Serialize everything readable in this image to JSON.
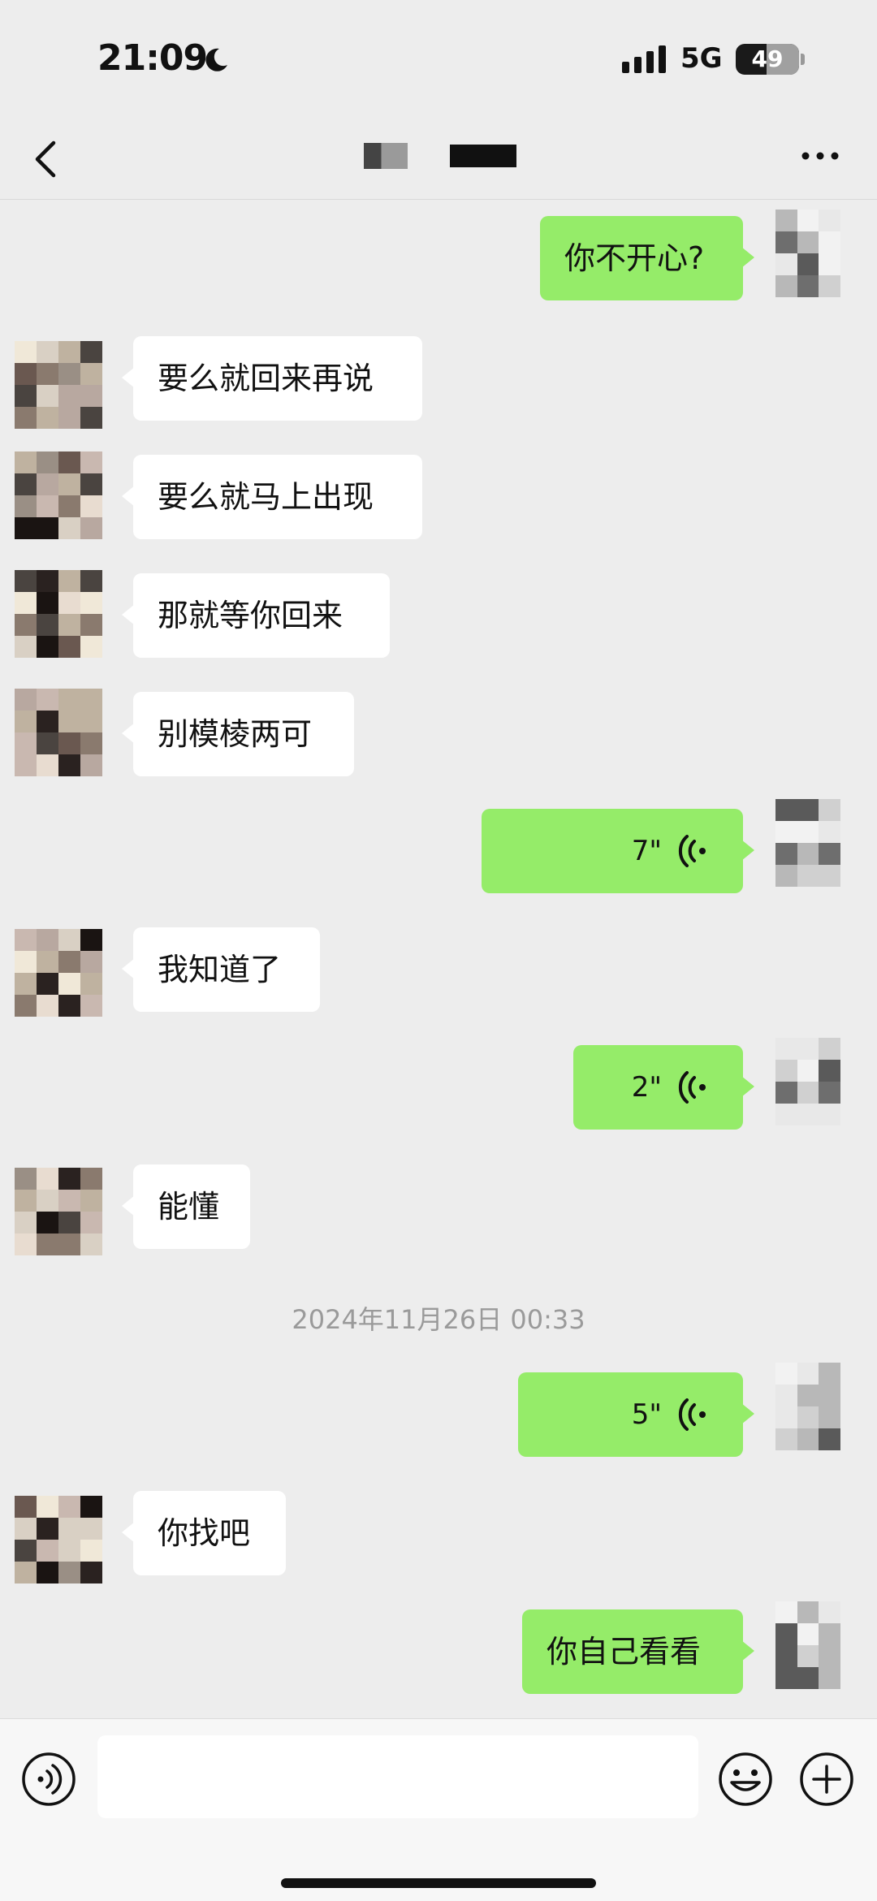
{
  "status_bar": {
    "time": "21:09",
    "network": "5G",
    "battery": "49",
    "moon_icon": "moon-icon",
    "signal_icon": "signal-icon"
  },
  "nav": {
    "back_icon": "chevron-left-icon",
    "more_icon": "more-horizontal-icon"
  },
  "messages": [
    {
      "side": "right",
      "type": "text",
      "text": "你不开心?"
    },
    {
      "side": "left",
      "type": "text",
      "text": "要么就回来再说"
    },
    {
      "side": "left",
      "type": "text",
      "text": "要么就马上出现"
    },
    {
      "side": "left",
      "type": "text",
      "text": "那就等你回来"
    },
    {
      "side": "left",
      "type": "text",
      "text": "别模棱两可"
    },
    {
      "side": "right",
      "type": "voice",
      "duration": "7\""
    },
    {
      "side": "left",
      "type": "text",
      "text": "我知道了"
    },
    {
      "side": "right",
      "type": "voice",
      "duration": "2\""
    },
    {
      "side": "left",
      "type": "text",
      "text": "能懂"
    },
    {
      "side": "right",
      "type": "voice",
      "duration": "5\""
    },
    {
      "side": "left",
      "type": "text",
      "text": "你找吧"
    },
    {
      "side": "right",
      "type": "text",
      "text": "你自己看看"
    }
  ],
  "timestamp": "2024年11月26日 00:33",
  "input_bar": {
    "voice_toggle_icon": "voice-input-icon",
    "emoji_icon": "emoji-icon",
    "plus_icon": "plus-icon",
    "placeholder": ""
  },
  "colors": {
    "background": "#ededed",
    "sent_bubble": "#95ec69",
    "received_bubble": "#ffffff",
    "timestamp_text": "#9a9a9a"
  }
}
